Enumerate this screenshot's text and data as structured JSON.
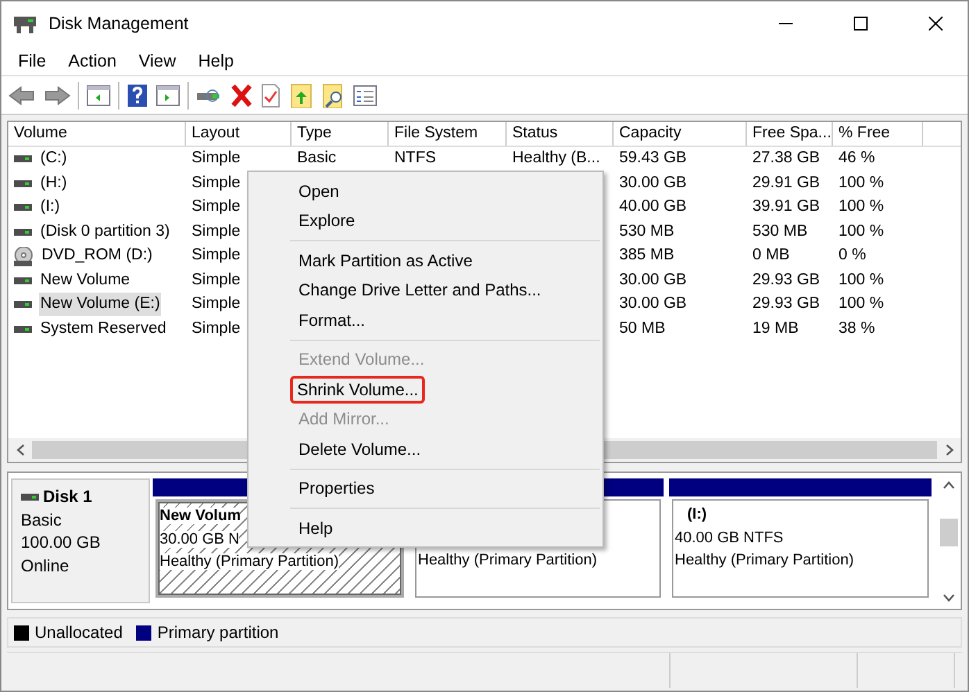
{
  "window": {
    "title": "Disk Management"
  },
  "menu_bar": [
    "File",
    "Action",
    "View",
    "Help"
  ],
  "table": {
    "columns": [
      "Volume",
      "Layout",
      "Type",
      "File System",
      "Status",
      "Capacity",
      "Free Spa...",
      "% Free"
    ],
    "rows": [
      {
        "kind": "drive",
        "selected": false,
        "cells": [
          "(C:)",
          "Simple",
          "Basic",
          "NTFS",
          "Healthy (B...",
          "59.43 GB",
          "27.38 GB",
          "46 %"
        ]
      },
      {
        "kind": "drive",
        "selected": false,
        "cells": [
          "(H:)",
          "Simple",
          null,
          null,
          null,
          "30.00 GB",
          "29.91 GB",
          "100 %"
        ]
      },
      {
        "kind": "drive",
        "selected": false,
        "cells": [
          "(I:)",
          "Simple",
          null,
          null,
          null,
          "40.00 GB",
          "39.91 GB",
          "100 %"
        ]
      },
      {
        "kind": "drive",
        "selected": false,
        "cells": [
          "(Disk 0 partition 3)",
          "Simple",
          null,
          null,
          null,
          "530 MB",
          "530 MB",
          "100 %"
        ]
      },
      {
        "kind": "dvd",
        "selected": false,
        "cells": [
          "DVD_ROM (D:)",
          "Simple",
          null,
          null,
          null,
          "385 MB",
          "0 MB",
          "0 %"
        ]
      },
      {
        "kind": "drive",
        "selected": false,
        "cells": [
          "New Volume",
          "Simple",
          null,
          null,
          null,
          "30.00 GB",
          "29.93 GB",
          "100 %"
        ]
      },
      {
        "kind": "drive",
        "selected": true,
        "cells": [
          "New Volume (E:)",
          "Simple",
          null,
          null,
          null,
          "30.00 GB",
          "29.93 GB",
          "100 %"
        ]
      },
      {
        "kind": "drive",
        "selected": false,
        "cells": [
          "System Reserved",
          "Simple",
          null,
          null,
          null,
          "50 MB",
          "19 MB",
          "38 %"
        ]
      }
    ]
  },
  "disk": {
    "name": "Disk 1",
    "type": "Basic",
    "size": "100.00 GB",
    "state": "Online",
    "partitions": [
      {
        "selected": true,
        "color": "#000080",
        "name": "New Volum",
        "size": "30.00 GB N",
        "status": "Healthy (Primary Partition)"
      },
      {
        "selected": false,
        "color": "#000080",
        "status": "Healthy (Primary Partition)"
      },
      {
        "selected": false,
        "color": "#000080",
        "name": "(I:)",
        "size": "40.00 GB NTFS",
        "status": "Healthy (Primary Partition)"
      }
    ]
  },
  "legend": [
    {
      "label": "Unallocated",
      "color": "#000000"
    },
    {
      "label": "Primary partition",
      "color": "#000080"
    }
  ],
  "context_menu": [
    {
      "kind": "item",
      "label": "Open",
      "disabled": false,
      "outlined": false
    },
    {
      "kind": "item",
      "label": "Explore",
      "disabled": false,
      "outlined": false
    },
    {
      "kind": "separator"
    },
    {
      "kind": "item",
      "label": "Mark Partition as Active",
      "disabled": false,
      "outlined": false
    },
    {
      "kind": "item",
      "label": "Change Drive Letter and Paths...",
      "disabled": false,
      "outlined": false
    },
    {
      "kind": "item",
      "label": "Format...",
      "disabled": false,
      "outlined": false
    },
    {
      "kind": "separator"
    },
    {
      "kind": "item",
      "label": "Extend Volume...",
      "disabled": true,
      "outlined": false
    },
    {
      "kind": "item",
      "label": "Shrink Volume...",
      "disabled": false,
      "outlined": true
    },
    {
      "kind": "item",
      "label": "Add Mirror...",
      "disabled": true,
      "outlined": false
    },
    {
      "kind": "item",
      "label": "Delete Volume...",
      "disabled": false,
      "outlined": false
    },
    {
      "kind": "separator"
    },
    {
      "kind": "item",
      "label": "Properties",
      "disabled": false,
      "outlined": false
    },
    {
      "kind": "separator"
    },
    {
      "kind": "item",
      "label": "Help",
      "disabled": false,
      "outlined": false
    }
  ]
}
